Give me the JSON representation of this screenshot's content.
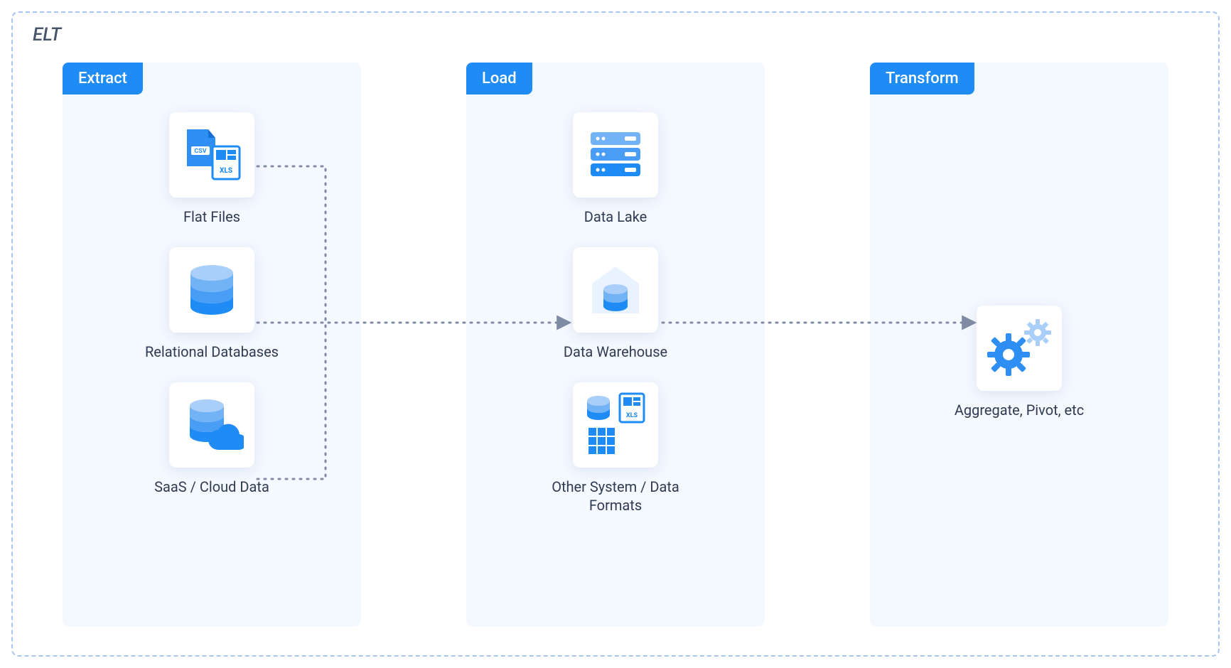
{
  "title": "ELT",
  "panels": {
    "extract": {
      "label": "Extract",
      "nodes": [
        {
          "label": "Flat Files",
          "icon": "csv-xls-file-icon"
        },
        {
          "label": "Relational Databases",
          "icon": "database-icon"
        },
        {
          "label": "SaaS / Cloud Data",
          "icon": "database-cloud-icon"
        }
      ]
    },
    "load": {
      "label": "Load",
      "nodes": [
        {
          "label": "Data Lake",
          "icon": "server-stack-icon"
        },
        {
          "label": "Data Warehouse",
          "icon": "warehouse-icon"
        },
        {
          "label": "Other System / Data Formats",
          "icon": "mixed-formats-icon"
        }
      ]
    },
    "transform": {
      "label": "Transform",
      "nodes": [
        {
          "label": "Aggregate, Pivot, etc",
          "icon": "gears-icon"
        }
      ]
    }
  },
  "flow": [
    "extract.flat-files -> load.data-warehouse",
    "extract.relational-databases -> load.data-warehouse",
    "extract.saas-cloud-data -> load.data-warehouse",
    "load.data-warehouse -> transform.aggregate-pivot-etc"
  ]
}
